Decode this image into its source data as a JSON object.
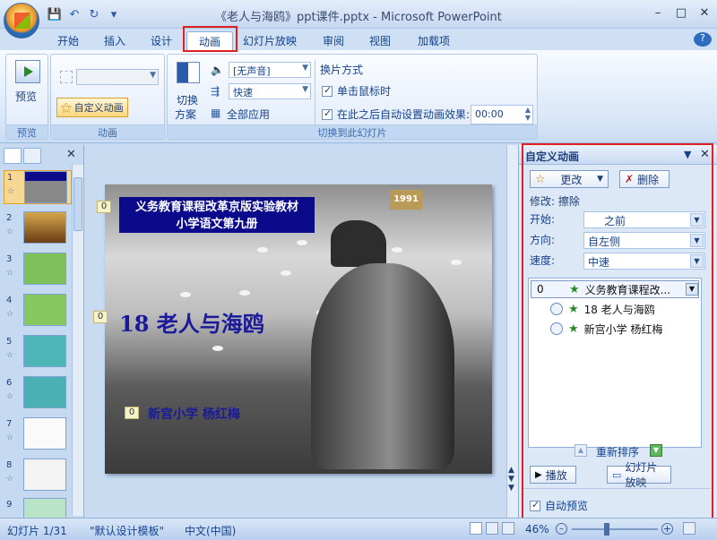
{
  "window": {
    "title": "《老人与海鸥》ppt课件.pptx - Microsoft PowerPoint",
    "controls": [
      "–",
      "□",
      "✕"
    ]
  },
  "qat": {
    "save": "💾",
    "undo": "↶",
    "redo": "↻",
    "more": "▾"
  },
  "tabs": [
    "开始",
    "插入",
    "设计",
    "动画",
    "幻灯片放映",
    "审阅",
    "视图",
    "加载项"
  ],
  "active_tab": "动画",
  "help_icon": "?",
  "ribbon": {
    "preview": {
      "label": "预览",
      "group": "预览"
    },
    "animation": {
      "custom_button": "自定义动画",
      "group": "动画"
    },
    "transition": {
      "switch_scheme_line1": "切换",
      "switch_scheme_line2": "方案",
      "sound_value": "[无声音]",
      "speed_value": "快速",
      "apply_all": "全部应用",
      "advance_header": "换片方式",
      "on_click": "单击鼠标时",
      "auto_after": "在此之后自动设置动画效果:",
      "time_value": "00:00",
      "group": "切换到此幻灯片"
    }
  },
  "slides": [
    {
      "num": "1"
    },
    {
      "num": "2"
    },
    {
      "num": "3"
    },
    {
      "num": "4"
    },
    {
      "num": "5"
    },
    {
      "num": "6"
    },
    {
      "num": "7"
    },
    {
      "num": "8"
    },
    {
      "num": "9"
    }
  ],
  "slide": {
    "textbox_line1": "义务教育课程改革京版实验教材",
    "textbox_line2": "小学语文第九册",
    "title": "18 老人与海鸥",
    "author": "新宫小学  杨红梅",
    "anim_tags": [
      "0",
      "0",
      "0"
    ],
    "logo_text": "1991"
  },
  "task_pane": {
    "title": "自定义动画",
    "change_button": "更改",
    "delete_button": "删除",
    "modify_label": "修改: 擦除",
    "start_label": "开始:",
    "start_value": "之前",
    "direction_label": "方向:",
    "direction_value": "自左侧",
    "speed_label": "速度:",
    "speed_value": "中速",
    "items": [
      {
        "num": "0",
        "text": "义务教育课程改..."
      },
      {
        "num": "",
        "text": "18 老人与海鸥"
      },
      {
        "num": "",
        "text": "新宫小学    杨红梅"
      }
    ],
    "reorder_label": "重新排序",
    "play_button": "播放",
    "slideshow_button": "幻灯片放映",
    "auto_preview": "自动预览"
  },
  "status": {
    "slide_info": "幻灯片 1/31",
    "theme": "\"默认设计模板\"",
    "language": "中文(中国)",
    "zoom": "46%"
  }
}
